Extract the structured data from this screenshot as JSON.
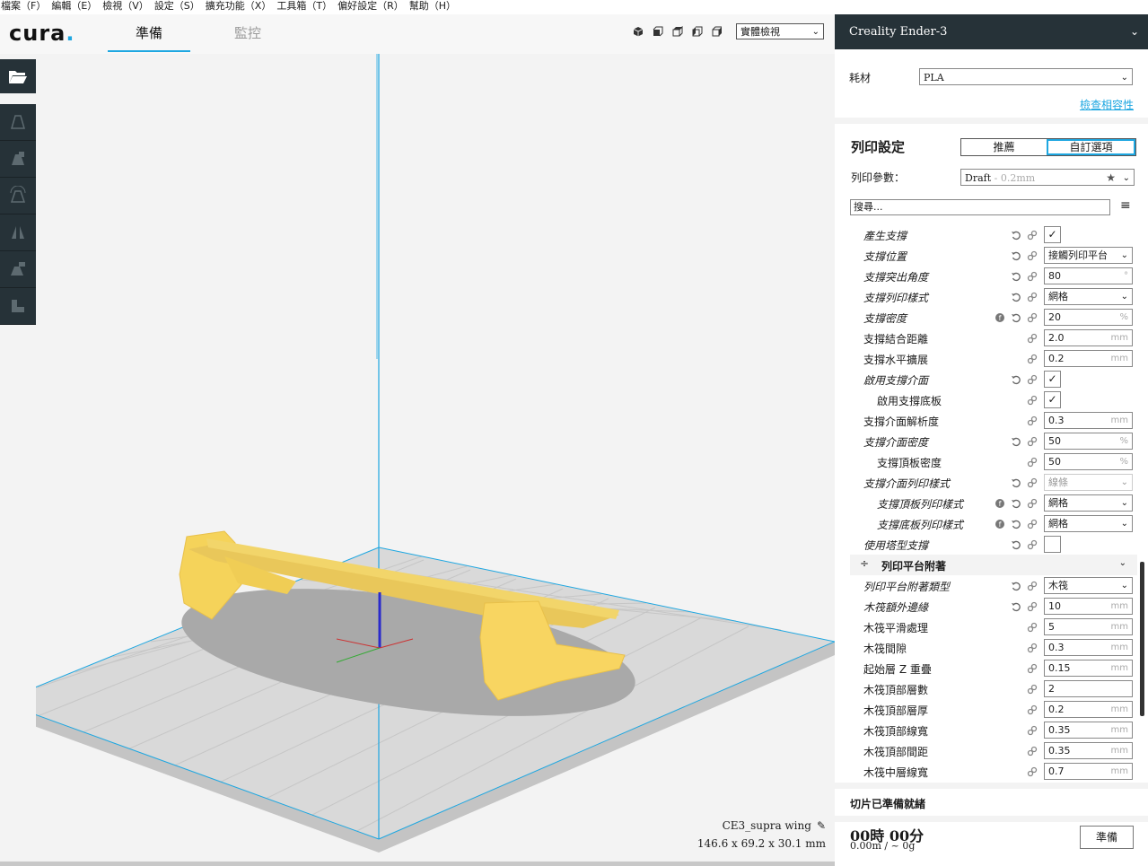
{
  "menu": [
    "檔案（F）",
    "編輯（E）",
    "檢視（V）",
    "設定（S）",
    "擴充功能（X）",
    "工具箱（T）",
    "偏好設定（R）",
    "幫助（H）"
  ],
  "app": {
    "logo": "cura",
    "logo_dot": "."
  },
  "stages": {
    "prepare": "準備",
    "monitor": "監控"
  },
  "view": {
    "select": "實體檢視",
    "buttons": [
      "3d-view-icon",
      "front-view-icon",
      "top-view-icon",
      "left-view-icon",
      "right-view-icon"
    ]
  },
  "tools": [
    "open-file-icon",
    "move-icon",
    "scale-icon",
    "rotate-icon",
    "mirror-icon",
    "per-model-settings-icon",
    "support-blocker-icon"
  ],
  "model": {
    "name": "CE3_supra wing",
    "dims": "146.6 x 69.2 x 30.1 mm",
    "color": "#f8d561"
  },
  "printer": {
    "name": "Creality Ender-3"
  },
  "material": {
    "label": "耗材",
    "value": "PLA",
    "compat_link": "檢查相容性"
  },
  "print_settings": {
    "title": "列印設定",
    "modes": [
      "推薦",
      "自訂選項"
    ],
    "profile_label": "列印參數：",
    "profile_value": "Draft",
    "profile_sub": " - 0.2mm",
    "search_placeholder": "搜尋..."
  },
  "settings": [
    {
      "label": "產生支撐",
      "italic": true,
      "sub": false,
      "icons": [
        "link",
        "reset"
      ],
      "type": "check",
      "value": "✓"
    },
    {
      "label": "支撐位置",
      "italic": true,
      "sub": false,
      "icons": [
        "link",
        "reset"
      ],
      "type": "select",
      "value": "接觸列印平台"
    },
    {
      "label": "支撐突出角度",
      "italic": true,
      "sub": false,
      "icons": [
        "link",
        "reset"
      ],
      "type": "input",
      "value": "80",
      "unit": "°"
    },
    {
      "label": "支撐列印樣式",
      "italic": true,
      "sub": false,
      "icons": [
        "link",
        "reset"
      ],
      "type": "select",
      "value": "網格"
    },
    {
      "label": "支撐密度",
      "italic": true,
      "sub": false,
      "icons": [
        "link",
        "reset",
        "func"
      ],
      "type": "input",
      "value": "20",
      "unit": "%"
    },
    {
      "label": "支撐結合距離",
      "italic": false,
      "sub": false,
      "icons": [
        "link"
      ],
      "type": "input",
      "value": "2.0",
      "unit": "mm"
    },
    {
      "label": "支撐水平擴展",
      "italic": false,
      "sub": false,
      "icons": [
        "link"
      ],
      "type": "input",
      "value": "0.2",
      "unit": "mm"
    },
    {
      "label": "啟用支撐介面",
      "italic": true,
      "sub": false,
      "icons": [
        "link",
        "reset"
      ],
      "type": "check",
      "value": "✓"
    },
    {
      "label": "啟用支撐底板",
      "italic": false,
      "sub": true,
      "icons": [
        "link"
      ],
      "type": "check",
      "value": "✓"
    },
    {
      "label": "支撐介面解析度",
      "italic": false,
      "sub": false,
      "icons": [
        "link"
      ],
      "type": "input",
      "value": "0.3",
      "unit": "mm"
    },
    {
      "label": "支撐介面密度",
      "italic": true,
      "sub": false,
      "icons": [
        "link",
        "reset"
      ],
      "type": "input",
      "value": "50",
      "unit": "%"
    },
    {
      "label": "支撐頂板密度",
      "italic": false,
      "sub": true,
      "icons": [
        "link"
      ],
      "type": "input",
      "value": "50",
      "unit": "%"
    },
    {
      "label": "支撐介面列印樣式",
      "italic": true,
      "sub": false,
      "icons": [
        "link",
        "reset"
      ],
      "type": "select",
      "value": "線條",
      "disabled": true
    },
    {
      "label": "支撐頂板列印樣式",
      "italic": true,
      "sub": true,
      "icons": [
        "link",
        "reset",
        "func"
      ],
      "type": "select",
      "value": "網格"
    },
    {
      "label": "支撐底板列印樣式",
      "italic": true,
      "sub": true,
      "icons": [
        "link",
        "reset",
        "func"
      ],
      "type": "select",
      "value": "網格"
    },
    {
      "label": "使用塔型支撐",
      "italic": true,
      "sub": false,
      "icons": [
        "link",
        "reset"
      ],
      "type": "check",
      "value": ""
    },
    {
      "category": "列印平台附著"
    },
    {
      "label": "列印平台附著類型",
      "italic": true,
      "sub": false,
      "icons": [
        "link",
        "reset"
      ],
      "type": "select",
      "value": "木筏"
    },
    {
      "label": "木筏額外邊緣",
      "italic": true,
      "sub": false,
      "icons": [
        "link",
        "reset"
      ],
      "type": "input",
      "value": "10",
      "unit": "mm"
    },
    {
      "label": "木筏平滑處理",
      "italic": false,
      "sub": false,
      "icons": [
        "link"
      ],
      "type": "input",
      "value": "5",
      "unit": "mm"
    },
    {
      "label": "木筏間隙",
      "italic": false,
      "sub": false,
      "icons": [
        "link"
      ],
      "type": "input",
      "value": "0.3",
      "unit": "mm"
    },
    {
      "label": "起始層 Z 重疊",
      "italic": false,
      "sub": false,
      "icons": [
        "link"
      ],
      "type": "input",
      "value": "0.15",
      "unit": "mm"
    },
    {
      "label": "木筏頂部層數",
      "italic": false,
      "sub": false,
      "icons": [
        "link"
      ],
      "type": "input",
      "value": "2",
      "unit": ""
    },
    {
      "label": "木筏頂部層厚",
      "italic": false,
      "sub": false,
      "icons": [
        "link"
      ],
      "type": "input",
      "value": "0.2",
      "unit": "mm"
    },
    {
      "label": "木筏頂部線寬",
      "italic": false,
      "sub": false,
      "icons": [
        "link"
      ],
      "type": "input",
      "value": "0.35",
      "unit": "mm"
    },
    {
      "label": "木筏頂部間距",
      "italic": false,
      "sub": false,
      "icons": [
        "link"
      ],
      "type": "input",
      "value": "0.35",
      "unit": "mm"
    },
    {
      "label": "木筏中層線寬",
      "italic": false,
      "sub": false,
      "icons": [
        "link"
      ],
      "type": "input",
      "value": "0.7",
      "unit": "mm"
    }
  ],
  "slice": {
    "status": "切片已準備就緒",
    "time": "00時 00分",
    "usage": "0.00m / ~ 0g",
    "button": "準備"
  },
  "colors": {
    "accent": "#1ea7e1",
    "dark": "#263238"
  }
}
